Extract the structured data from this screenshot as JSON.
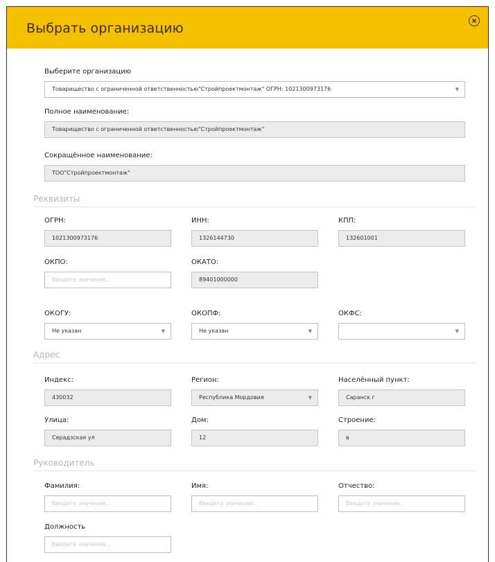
{
  "header": {
    "title": "Выбрать организацию"
  },
  "org": {
    "select_label": "Выберите организацию",
    "select_value": "Товарищество с ограниченной ответственностью\"Стройпроектмонтаж\" ОГРН: 1021300973176",
    "full_name_label": "Полное наименование:",
    "full_name_value": "Товарищество с ограниченной ответственностью\"Стройпроектмонтаж\"",
    "short_name_label": "Сокращённое наименование:",
    "short_name_value": "ТОО\"Стройпроектмонтаж\""
  },
  "requisites": {
    "section_title": "Реквизиты",
    "ogrn_label": "ОГРН:",
    "ogrn_value": "1021300973176",
    "inn_label": "ИНН:",
    "inn_value": "1326144730",
    "kpp_label": "КПП:",
    "kpp_value": "132601001",
    "okpo_label": "ОКПО:",
    "okpo_placeholder": "Введите значение...",
    "okato_label": "ОКАТО:",
    "okato_value": "89401000000",
    "okogu_label": "ОКОГУ:",
    "okogu_value": "Не указан",
    "okopf_label": "ОКОПФ:",
    "okopf_value": "Не указан",
    "okfs_label": "ОКФС:",
    "okfs_value": ""
  },
  "address": {
    "section_title": "Адрес",
    "index_label": "Индекс:",
    "index_value": "430032",
    "region_label": "Регион:",
    "region_value": "Республика Мордовия",
    "locality_label": "Населённый пункт:",
    "locality_value": "Саранск г",
    "street_label": "Улица:",
    "street_value": "Серадзская ул",
    "house_label": "Дом:",
    "house_value": "12",
    "building_label": "Строение:",
    "building_value": "в"
  },
  "head": {
    "section_title": "Руководитель",
    "surname_label": "Фамилия:",
    "surname_placeholder": "Введите значение...",
    "name_label": "Имя:",
    "name_placeholder": "Введите значение...",
    "patronymic_label": "Отчество:",
    "patronymic_placeholder": "Введите значение...",
    "position_label": "Должность",
    "position_placeholder": "Введите значение..."
  },
  "icons": {
    "close": "close-circle-icon",
    "dropdown": "chevron-down-icon"
  },
  "colors": {
    "header_bg": "#f5c000",
    "readonly_bg": "#ececec",
    "section_text": "#b8b8b8"
  }
}
